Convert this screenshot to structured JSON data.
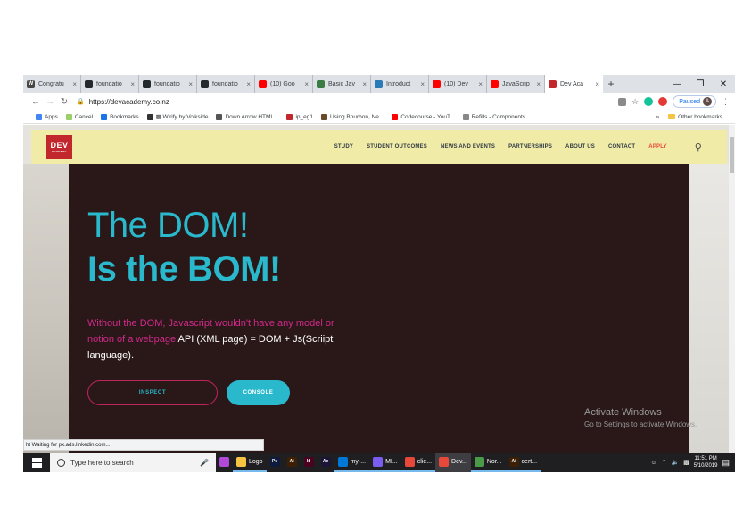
{
  "browser": {
    "tabs": [
      {
        "label": "Congratu",
        "icon": "wordpress-icon",
        "color": "#464646",
        "glyph": "W"
      },
      {
        "label": "foundatio",
        "icon": "github-icon",
        "color": "#24292e",
        "glyph": ""
      },
      {
        "label": "foundatio",
        "icon": "github-icon",
        "color": "#24292e",
        "glyph": ""
      },
      {
        "label": "foundatio",
        "icon": "github-icon",
        "color": "#24292e",
        "glyph": ""
      },
      {
        "label": "(10) Goo",
        "icon": "youtube-icon",
        "color": "#ff0000",
        "glyph": ""
      },
      {
        "label": "Basic Jav",
        "icon": "codepen-icon",
        "color": "#3a7d44",
        "glyph": ""
      },
      {
        "label": "Introduct",
        "icon": "page-icon",
        "color": "#2a7ab8",
        "glyph": ""
      },
      {
        "label": "(10) Dev",
        "icon": "youtube-icon",
        "color": "#ff0000",
        "glyph": ""
      },
      {
        "label": "JavaScrip",
        "icon": "youtube-icon",
        "color": "#ff0000",
        "glyph": ""
      },
      {
        "label": "Dev Aca",
        "icon": "devacademy-icon",
        "color": "#c2272d",
        "glyph": ""
      }
    ],
    "url": "https://devacademy.co.nz",
    "profile_status": "Paused",
    "profile_initial": "A",
    "bookmarks": [
      {
        "label": "Apps",
        "icon": "apps-icon",
        "color": "#4285f4"
      },
      {
        "label": "Cancel",
        "icon": "cancel-icon",
        "color": "#9ccf6a"
      },
      {
        "label": "Bookmarks",
        "icon": "star-icon",
        "color": "#1a73e8"
      },
      {
        "label": "▩ Wirify by Volkside",
        "icon": "globe-icon",
        "color": "#333333"
      },
      {
        "label": "Down Arrow HTML...",
        "icon": "page-icon",
        "color": "#555555"
      },
      {
        "label": "ip_eg1",
        "icon": "flag-icon",
        "color": "#c2272d"
      },
      {
        "label": "Using Bourbon, Ne...",
        "icon": "bourbon-icon",
        "color": "#6b4a2b"
      },
      {
        "label": "Codecourse - YouT...",
        "icon": "youtube-icon",
        "color": "#ff0000"
      },
      {
        "label": "Refills - Components",
        "icon": "refills-icon",
        "color": "#888888"
      }
    ],
    "bookmarks_overflow": "»",
    "other_bookmarks": "Other bookmarks",
    "status_text": "ht Waiting for px.ads.linkedin.com..."
  },
  "site": {
    "logo_top": "DEV",
    "logo_bottom": "ACADEMY",
    "nav": [
      "STUDY",
      "STUDENT OUTCOMES",
      "NEWS AND EVENTS",
      "PARTNERSHIPS",
      "ABOUT US",
      "CONTACT"
    ],
    "nav_apply": "APPLY",
    "hero": {
      "line1": "The DOM!",
      "line2": "Is the BOM!",
      "desc_pink": "Without the DOM, Javascript wouldn't have any model or notion of a webpage",
      "desc_white": "API (XML page) = DOM + Js(Scriipt language)",
      "desc_end": ".",
      "btn_inspect": "INSPECT",
      "btn_console": "CONSOLE"
    },
    "activate_title": "Activate Windows",
    "activate_sub": "Go to Settings to activate Windows."
  },
  "taskbar": {
    "search_placeholder": "Type here to search",
    "apps": [
      {
        "label": "",
        "icon": "app-icon",
        "color": "#b049d8",
        "glyph": "",
        "state": ""
      },
      {
        "label": "Logo",
        "icon": "folder-icon",
        "color": "#f6c343",
        "glyph": "",
        "state": "running"
      },
      {
        "label": "",
        "icon": "photoshop-icon",
        "color": "#0f1b3d",
        "glyph": "Ps",
        "state": ""
      },
      {
        "label": "",
        "icon": "illustrator-icon",
        "color": "#3d1f04",
        "glyph": "Ai",
        "state": ""
      },
      {
        "label": "",
        "icon": "indesign-icon",
        "color": "#49021f",
        "glyph": "Id",
        "state": ""
      },
      {
        "label": "",
        "icon": "aftereffects-icon",
        "color": "#1b1538",
        "glyph": "Ae",
        "state": ""
      },
      {
        "label": "my-...",
        "icon": "vscode-icon",
        "color": "#0078d7",
        "glyph": "",
        "state": "running"
      },
      {
        "label": "MI...",
        "icon": "app-icon",
        "color": "#7a5cf0",
        "glyph": "",
        "state": "running"
      },
      {
        "label": "clie...",
        "icon": "chrome-icon",
        "color": "#e8483a",
        "glyph": "",
        "state": "running"
      },
      {
        "label": "Dev...",
        "icon": "chrome-icon",
        "color": "#e8483a",
        "glyph": "",
        "state": "active"
      },
      {
        "label": "Nor...",
        "icon": "app-icon",
        "color": "#4a9a4a",
        "glyph": "",
        "state": "running"
      },
      {
        "label": "cert...",
        "icon": "illustrator-icon",
        "color": "#3d1f04",
        "glyph": "Ai",
        "state": "running"
      }
    ],
    "time": "11:51 PM",
    "date": "5/10/2019"
  }
}
